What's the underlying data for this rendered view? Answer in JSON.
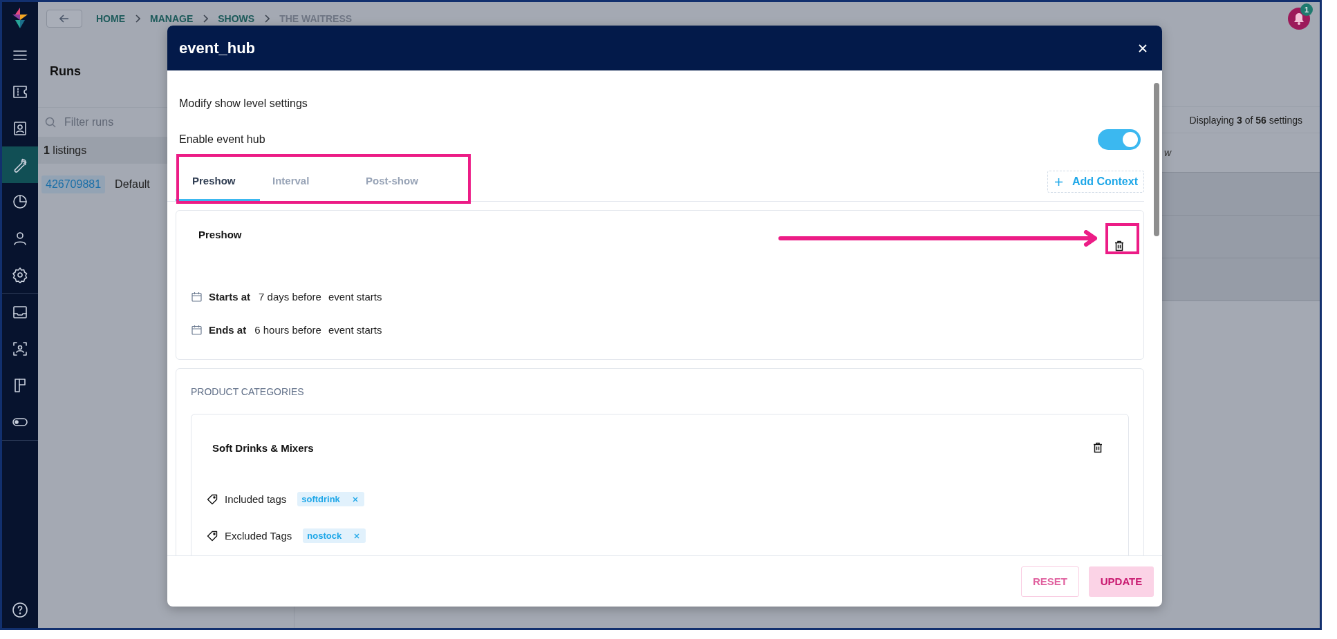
{
  "sidebar": {
    "items": [
      {
        "selected": false
      },
      {
        "selected": false
      },
      {
        "selected": false
      },
      {
        "selected": true
      },
      {
        "selected": false
      },
      {
        "selected": false
      },
      {
        "selected": false
      },
      {
        "selected": false
      },
      {
        "selected": false
      },
      {
        "selected": false
      },
      {
        "selected": false
      }
    ]
  },
  "breadcrumbs": [
    {
      "label": "HOME",
      "current": false
    },
    {
      "label": "MANAGE",
      "current": false
    },
    {
      "label": "SHOWS",
      "current": false
    },
    {
      "label": "THE WAITRESS",
      "current": true
    }
  ],
  "notifications": {
    "count": "1"
  },
  "runs_panel": {
    "title": "Runs",
    "filter_placeholder": "Filter runs",
    "listings_count": "1",
    "listings_label": "listings",
    "runs": [
      {
        "id": "426709881",
        "name": "Default"
      }
    ]
  },
  "settings_panel": {
    "summary": "Displaying **3** of **56** settings",
    "column_1": "w"
  },
  "modal": {
    "title": "event_hub",
    "subtitle": "Modify show level settings",
    "enable_label": "Enable event hub",
    "enabled": true,
    "tabs": [
      {
        "label": "Preshow",
        "selected": true
      },
      {
        "label": "Interval",
        "selected": false
      },
      {
        "label": "Post-show",
        "selected": false
      }
    ],
    "add_context": "Add Context",
    "context": {
      "title": "Preshow",
      "schedule": [
        {
          "label": "Starts at",
          "value": "7 days before",
          "suffix": "event starts"
        },
        {
          "label": "Ends at",
          "value": "6 hours before",
          "suffix": "event starts"
        }
      ]
    },
    "product_categories": {
      "heading": "PRODUCT CATEGORIES",
      "categories": [
        {
          "name": "Soft Drinks & Mixers",
          "tag_groups": [
            {
              "label": "Included tags",
              "tags": [
                "softdrink"
              ]
            },
            {
              "label": "Excluded Tags",
              "tags": [
                "nostock"
              ]
            }
          ]
        }
      ]
    },
    "buttons": [
      {
        "label": "RESET",
        "kind": "outline",
        "disabled": true
      },
      {
        "label": "UPDATE",
        "kind": "filled",
        "disabled": true
      }
    ]
  }
}
